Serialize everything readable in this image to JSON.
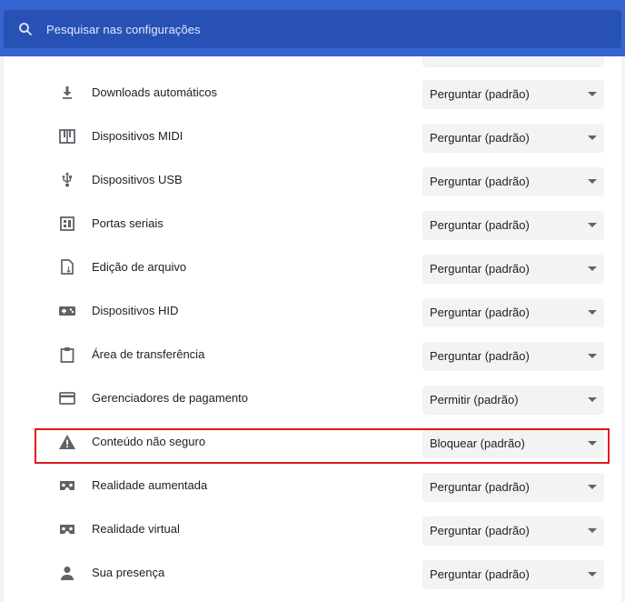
{
  "search": {
    "placeholder": "Pesquisar nas configurações"
  },
  "colors": {
    "header": "#3465d0",
    "search_box": "#2851b5",
    "highlight_border": "#e0181c",
    "select_bg": "#f1f3f4",
    "icon": "#5f6368"
  },
  "rows": [
    {
      "label": "Downloads automáticos",
      "value": "Perguntar (padrão)",
      "icon": "download-icon"
    },
    {
      "label": "Dispositivos MIDI",
      "value": "Perguntar (padrão)",
      "icon": "piano-icon"
    },
    {
      "label": "Dispositivos USB",
      "value": "Perguntar (padrão)",
      "icon": "usb-icon"
    },
    {
      "label": "Portas seriais",
      "value": "Perguntar (padrão)",
      "icon": "serial-port-icon"
    },
    {
      "label": "Edição de arquivo",
      "value": "Perguntar (padrão)",
      "icon": "file-edit-icon"
    },
    {
      "label": "Dispositivos HID",
      "value": "Perguntar (padrão)",
      "icon": "gamepad-icon"
    },
    {
      "label": "Área de transferência",
      "value": "Perguntar (padrão)",
      "icon": "clipboard-icon"
    },
    {
      "label": "Gerenciadores de pagamento",
      "value": "Permitir (padrão)",
      "icon": "credit-card-icon"
    },
    {
      "label": "Conteúdo não seguro",
      "value": "Bloquear (padrão)",
      "icon": "warning-icon",
      "highlighted": true
    },
    {
      "label": "Realidade aumentada",
      "value": "Perguntar (padrão)",
      "icon": "vr-headset-icon"
    },
    {
      "label": "Realidade virtual",
      "value": "Perguntar (padrão)",
      "icon": "vr-headset-icon"
    },
    {
      "label": "Sua presença",
      "value": "Perguntar (padrão)",
      "icon": "person-icon"
    }
  ]
}
